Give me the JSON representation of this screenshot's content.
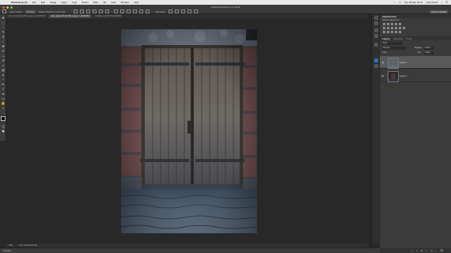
{
  "menubar": {
    "apple": "",
    "app": "Photoshop CC",
    "items": [
      "File",
      "Edit",
      "Image",
      "Layer",
      "Type",
      "Select",
      "Filter",
      "3D",
      "View",
      "Window",
      "Help"
    ],
    "clock": "Tue 28 Mar 22:31",
    "user": "Glyn Dewis"
  },
  "window": {
    "title": "Adobe Photoshop CC 2015"
  },
  "options": {
    "auto_select": "Auto-Select:",
    "group": "Group",
    "show_transform": "Show Transform Controls",
    "mode": "3D Mode:",
    "workspace": "Glyn's Default"
  },
  "tabs": [
    {
      "label": "INV_4444.tif @ 25% (Layer 1, RGB/16*)",
      "active": false
    },
    {
      "label": "dark_aspect.tif @ 25% (Layer 1, RGB/16*)",
      "active": true
    },
    {
      "label": "Untitled-1 @ 66.7% (RGB/8)",
      "active": false
    }
  ],
  "status": {
    "zoom": "25%",
    "doc": "Doc: 92.2M/160.2M"
  },
  "timeline": {
    "label": "Timeline"
  },
  "panels": {
    "adjustments": {
      "title": "Adjustments",
      "subtitle": "Add an adjustment"
    },
    "layers": {
      "tabs": [
        "Layers",
        "Channels",
        "Paths"
      ],
      "kind": "Kind",
      "blend": "Normal",
      "opacity_label": "Opacity:",
      "opacity": "100%",
      "lock_label": "Lock:",
      "fill_label": "Fill:",
      "fill": "100%",
      "items": [
        {
          "name": "Layer 1",
          "selected": true
        },
        {
          "name": "Layer 0",
          "selected": false
        }
      ]
    }
  },
  "colors": {
    "fg": "#111111",
    "bg": "#f2f2f2",
    "accent": "#2f6fc0"
  }
}
